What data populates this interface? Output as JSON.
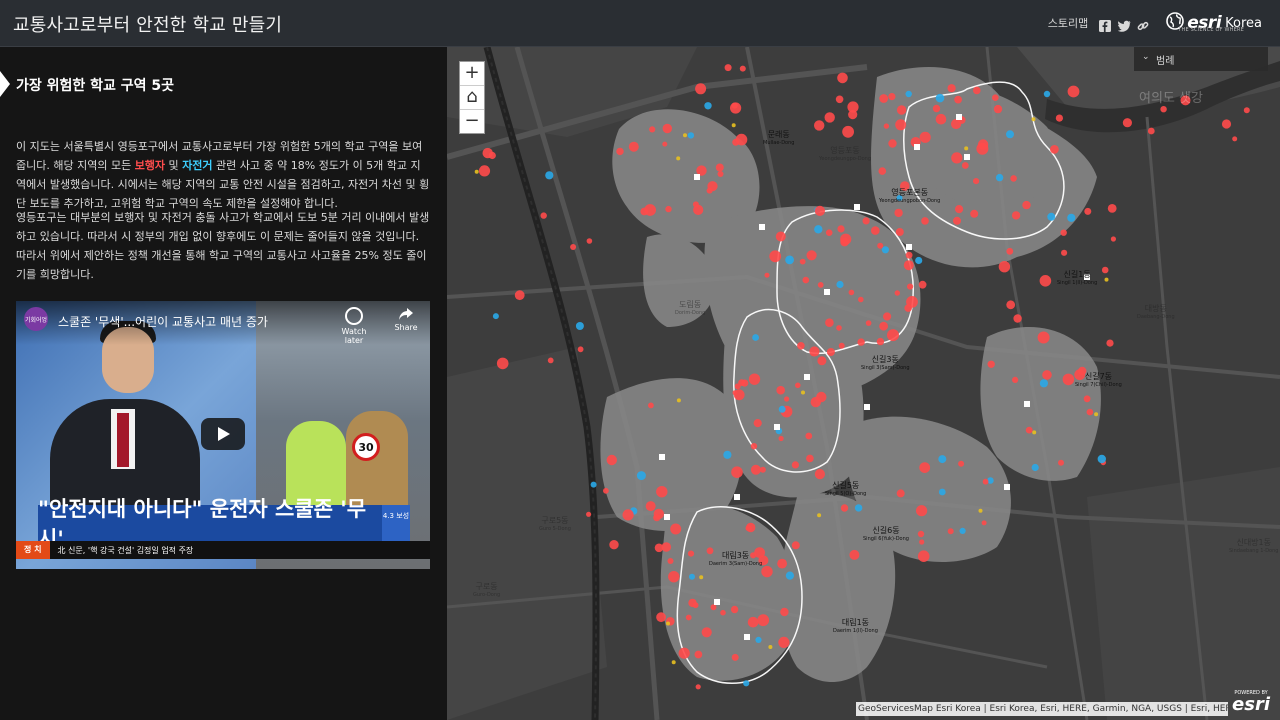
{
  "header": {
    "title": "교통사고로부터 안전한 학교 만들기",
    "story_label": "스토리맵",
    "esri_logo": "esri",
    "esri_country": "Korea",
    "esri_tagline": "THE SCIENCE OF WHERE",
    "icons": [
      "facebook-icon",
      "twitter-icon",
      "link-icon",
      "globe-icon"
    ]
  },
  "side": {
    "section_title": "가장 위험한 학교 구역 5곳",
    "p1": {
      "a": "이 지도는 서울특별시 영등포구에서 교통사고로부터 가장 위험한 5개의 학교 구역을 보여줍니다. 해당 지역의 모든 ",
      "pedestrian": "보행자",
      "b": " 및 ",
      "bicycle": "자전거",
      "c": " 관련 사고 중 약 18% 정도가 이 5개 학교 지역에서 발생했습니다. 시에서는 해당 지역의 교통 안전 시설을 점검하고, 자전거 차선 및 횡단 보도를 추가하고, 고위험 학교 구역의 속도 제한을 설정해야 합니다."
    },
    "p2": "영등포구는 대부분의 보행자 및 자전거 충돌 사고가 학교에서 도보 5분 거리 이내에서 발생하고 있습니다. 따라서 시 정부의 개입 없이 향후에도 이 문제는 줄어들지 않을 것입니다. 따라서 위에서 제안하는 정책 개선을 통해 학교 구역의 교통사고 사고율을 25% 정도 줄이기를 희망합니다.",
    "colors": {
      "pedestrian": "#ff4d4d",
      "bicycle": "#3ed0ff"
    }
  },
  "video": {
    "channel": "기회어엉",
    "title": "스쿨존 '무색'...어린이 교통사고 매년 증가",
    "watch_later": "Watch later",
    "share": "Share",
    "caption": "\"안전지대 아니다\" 운전자 스쿨존 '무시'",
    "badge": "4.3 보성",
    "ticker_category": "정 치",
    "ticker_text": "北 신문, '핵 강국 건설' 김정일 업적 주장",
    "sign_text": "30"
  },
  "map": {
    "zoom_in": "+",
    "home": "⌂",
    "zoom_out": "−",
    "legend_label": "범례",
    "attribution": "GeoServicesMap Esri Korea | Esri Korea, Esri, HERE, Garmin, NGA, USGS | Esri, HERE, Gar...",
    "powered_by": "POWERED BY",
    "powered_logo": "esri",
    "labels": [
      {
        "name": "문래동",
        "sub": "Mullae-Dong"
      },
      {
        "name": "영등포본동",
        "sub": "Yeongdeungpobon-Dong"
      },
      {
        "name": "영등포동",
        "sub": "Yeongdeungpo-Dong"
      },
      {
        "name": "도림동",
        "sub": "Dorim-Dong"
      },
      {
        "name": "신길3동",
        "sub": "Singil 3(Sam)-Dong"
      },
      {
        "name": "신길1동",
        "sub": "Singil 1(Il)-Dong"
      },
      {
        "name": "신길7동",
        "sub": "Singil 7(Chil)-Dong"
      },
      {
        "name": "신길5동",
        "sub": "Singil 5(O)-Dong"
      },
      {
        "name": "신길6동",
        "sub": "Singil 6(Yuk)-Dong"
      },
      {
        "name": "대림3동",
        "sub": "Daerim 3(Sam)-Dong"
      },
      {
        "name": "대림1동",
        "sub": "Daerim 1(Il)-Dong"
      },
      {
        "name": "여의도 샛강",
        "sub": ""
      },
      {
        "name": "대방동",
        "sub": "Daebang-Dong"
      },
      {
        "name": "구로5동",
        "sub": "Guro 5-Dong"
      },
      {
        "name": "구로동",
        "sub": "Guro-Dong"
      },
      {
        "name": "신대방1동",
        "sub": "Sindaebang 1-Dong"
      }
    ],
    "colors": {
      "pedestrian": "#ff4a4a",
      "bicycle": "#2aa8e8",
      "other": "#e8c020",
      "school": "#ffffff",
      "zone_outline": "#ffffff",
      "buffer": "#8a8a8a"
    }
  }
}
